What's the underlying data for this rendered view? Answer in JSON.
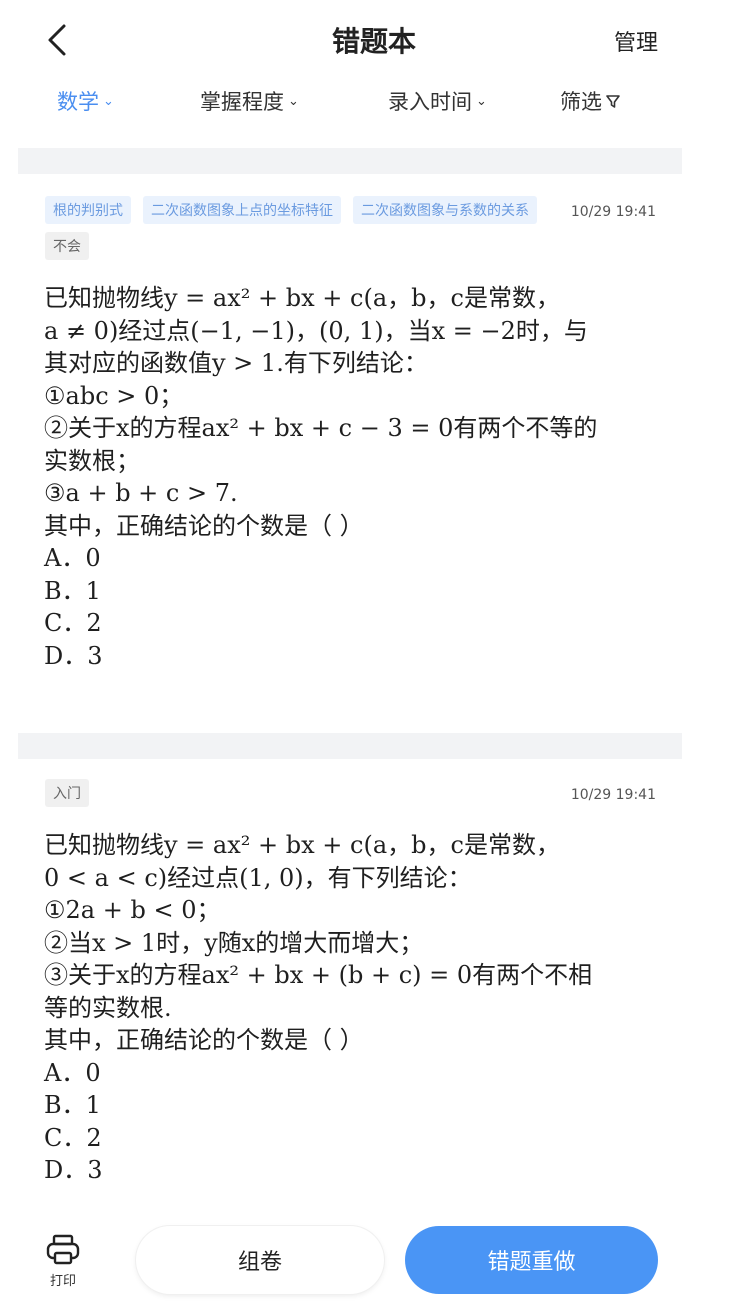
{
  "header": {
    "title": "错题本",
    "manage_label": "管理"
  },
  "filters": [
    {
      "label": "数学",
      "active": true
    },
    {
      "label": "掌握程度",
      "active": false
    },
    {
      "label": "录入时间",
      "active": false
    },
    {
      "label": "筛选",
      "active": false
    }
  ],
  "cards": [
    {
      "tags": [
        "根的判别式",
        "二次函数图象上点的坐标特征",
        "二次函数图象与系数的关系",
        "不会"
      ],
      "time": "10/29 19:41",
      "question_lines": [
        "已知抛物线y = ax² + bx + c(a，b，c是常数，",
        "a ≠ 0)经过点(−1, −1)，(0, 1)，当x = −2时，与",
        "其对应的函数值y > 1.有下列结论：",
        "①abc > 0；",
        "②关于x的方程ax² + bx + c − 3 = 0有两个不等的",
        "实数根；",
        "③a + b + c > 7.",
        "其中，正确结论的个数是（ ）",
        "A．0",
        "B．1",
        "C．2",
        "D．3"
      ]
    },
    {
      "tags": [
        "入门"
      ],
      "time": "10/29 19:41",
      "question_lines": [
        "已知抛物线y = ax² + bx + c(a，b，c是常数，",
        "0 < a < c)经过点(1, 0)，有下列结论：",
        "①2a + b < 0；",
        "②当x > 1时，y随x的增大而增大；",
        "③关于x的方程ax² + bx + (b + c) = 0有两个不相",
        "等的实数根.",
        "其中，正确结论的个数是（ ）",
        "A．0",
        "B．1",
        "C．2",
        "D．3"
      ]
    }
  ],
  "bottom": {
    "print_label": "打印",
    "compose_label": "组卷",
    "redo_label": "错题重做"
  },
  "colors": {
    "accent": "#4a95f5",
    "tag_text": "#6b9be0",
    "tag_bg": "#eaf2fd",
    "separator": "#f2f3f5"
  }
}
